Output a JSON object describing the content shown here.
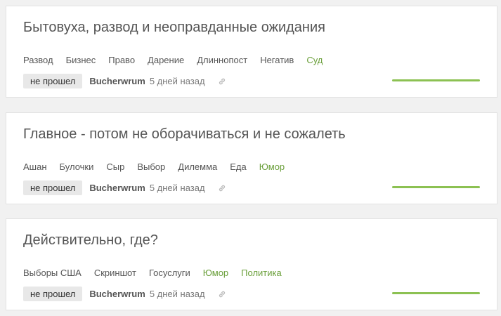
{
  "colors": {
    "background": "#f1f1f1",
    "card": "#ffffff",
    "tag_highlight": "#6a9f3a",
    "rating_fill": "#8cc152",
    "badge_bg": "#e8e8e8"
  },
  "posts": [
    {
      "title": "Бытовуха, развод и неоправданные ожидания",
      "tags": [
        {
          "label": "Развод",
          "highlight": false
        },
        {
          "label": "Бизнес",
          "highlight": false
        },
        {
          "label": "Право",
          "highlight": false
        },
        {
          "label": "Дарение",
          "highlight": false
        },
        {
          "label": "Длиннопост",
          "highlight": false
        },
        {
          "label": "Негатив",
          "highlight": false
        },
        {
          "label": "Суд",
          "highlight": true
        }
      ],
      "status": "не прошел",
      "author": "Bucherwrum",
      "time": "5 дней назад",
      "icon": "link-icon",
      "rating_fraction": 1.0
    },
    {
      "title": "Главное - потом не оборачиваться и не сожалеть",
      "tags": [
        {
          "label": "Ашан",
          "highlight": false
        },
        {
          "label": "Булочки",
          "highlight": false
        },
        {
          "label": "Сыр",
          "highlight": false
        },
        {
          "label": "Выбор",
          "highlight": false
        },
        {
          "label": "Дилемма",
          "highlight": false
        },
        {
          "label": "Еда",
          "highlight": false
        },
        {
          "label": "Юмор",
          "highlight": true
        }
      ],
      "status": "не прошел",
      "author": "Bucherwrum",
      "time": "5 дней назад",
      "icon": "link-icon",
      "rating_fraction": 1.0
    },
    {
      "title": "Действительно, где?",
      "tags": [
        {
          "label": "Выборы США",
          "highlight": false
        },
        {
          "label": "Скриншот",
          "highlight": false
        },
        {
          "label": "Госуслуги",
          "highlight": false
        },
        {
          "label": "Юмор",
          "highlight": true
        },
        {
          "label": "Политика",
          "highlight": true
        }
      ],
      "status": "не прошел",
      "author": "Bucherwrum",
      "time": "5 дней назад",
      "icon": "link-icon",
      "rating_fraction": 1.0
    }
  ]
}
